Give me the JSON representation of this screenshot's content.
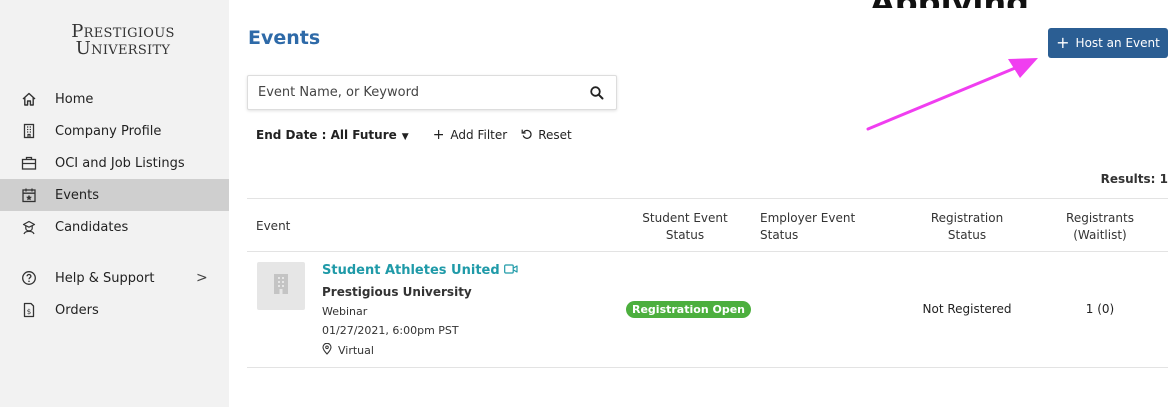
{
  "overlay": {
    "text": "Applying"
  },
  "brand": {
    "line1": "Prestigious",
    "line2": "University"
  },
  "sidebar": {
    "items": [
      {
        "label": "Home",
        "icon": "home-icon"
      },
      {
        "label": "Company Profile",
        "icon": "building-icon"
      },
      {
        "label": "OCI and Job Listings",
        "icon": "briefcase-icon"
      },
      {
        "label": "Events",
        "icon": "calendar-icon",
        "active": true
      },
      {
        "label": "Candidates",
        "icon": "candidates-icon"
      },
      {
        "label": "Help & Support",
        "icon": "help-icon",
        "chevron": ">"
      },
      {
        "label": "Orders",
        "icon": "receipt-icon"
      }
    ]
  },
  "page": {
    "title": "Events"
  },
  "host_button": {
    "label": "Host an Event"
  },
  "search": {
    "placeholder": "Event Name, or Keyword",
    "value": ""
  },
  "filters": {
    "end_date": "End Date : All Future",
    "add_filter": "Add Filter",
    "reset": "Reset"
  },
  "results": {
    "text": "Results: 1"
  },
  "table": {
    "headers": {
      "event": "Event",
      "student_status": "Student Event Status",
      "employer_status": "Employer Event Status",
      "registration_status": "Registration Status",
      "registrants": "Registrants (Waitlist)"
    },
    "rows": [
      {
        "title": "Student Athletes United",
        "organizer": "Prestigious University",
        "type": "Webinar",
        "datetime": "01/27/2021, 6:00pm PST",
        "location": "Virtual",
        "student_status": "Registration Open",
        "employer_status": "",
        "registration_status": "Not Registered",
        "registrants": "1 (0)"
      }
    ]
  },
  "colors": {
    "accent": "#2e6aa8",
    "button": "#2b5e93",
    "link": "#1f9aa8",
    "badge": "#4caf3e",
    "annotation_arrow": "#f03ef0"
  }
}
